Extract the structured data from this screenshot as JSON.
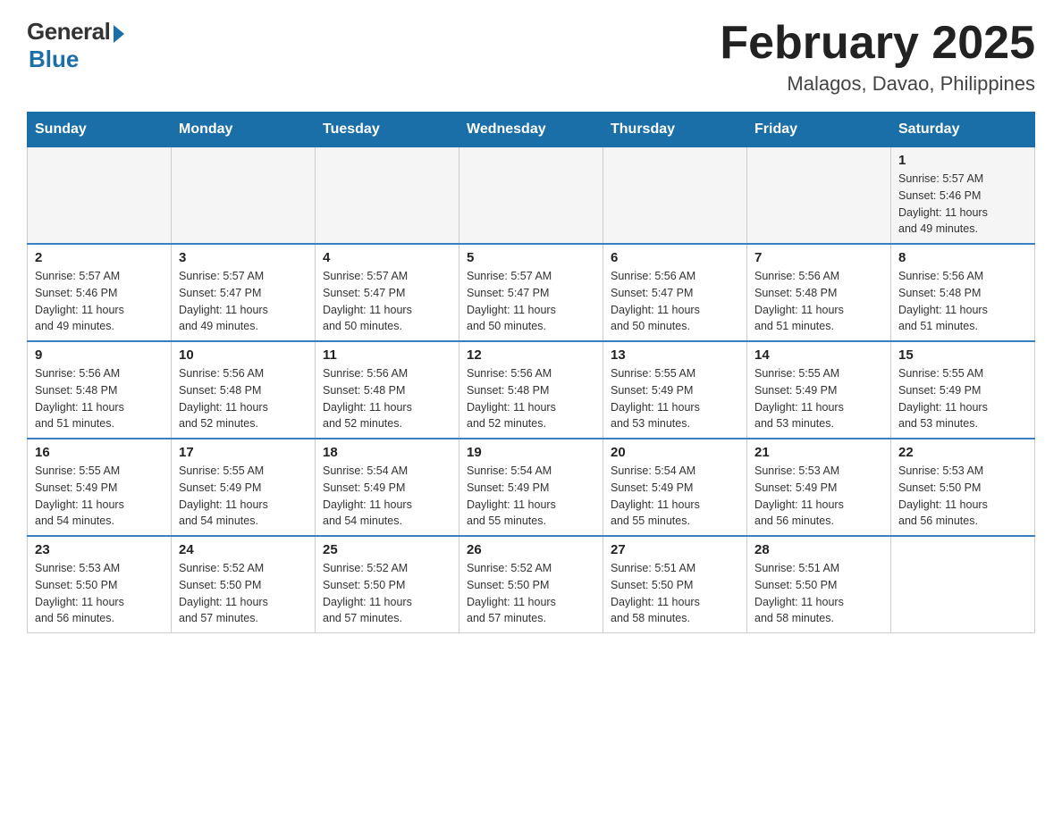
{
  "logo": {
    "general": "General",
    "blue": "Blue"
  },
  "title": "February 2025",
  "subtitle": "Malagos, Davao, Philippines",
  "days_of_week": [
    "Sunday",
    "Monday",
    "Tuesday",
    "Wednesday",
    "Thursday",
    "Friday",
    "Saturday"
  ],
  "weeks": [
    [
      {
        "day": "",
        "info": ""
      },
      {
        "day": "",
        "info": ""
      },
      {
        "day": "",
        "info": ""
      },
      {
        "day": "",
        "info": ""
      },
      {
        "day": "",
        "info": ""
      },
      {
        "day": "",
        "info": ""
      },
      {
        "day": "1",
        "info": "Sunrise: 5:57 AM\nSunset: 5:46 PM\nDaylight: 11 hours\nand 49 minutes."
      }
    ],
    [
      {
        "day": "2",
        "info": "Sunrise: 5:57 AM\nSunset: 5:46 PM\nDaylight: 11 hours\nand 49 minutes."
      },
      {
        "day": "3",
        "info": "Sunrise: 5:57 AM\nSunset: 5:47 PM\nDaylight: 11 hours\nand 49 minutes."
      },
      {
        "day": "4",
        "info": "Sunrise: 5:57 AM\nSunset: 5:47 PM\nDaylight: 11 hours\nand 50 minutes."
      },
      {
        "day": "5",
        "info": "Sunrise: 5:57 AM\nSunset: 5:47 PM\nDaylight: 11 hours\nand 50 minutes."
      },
      {
        "day": "6",
        "info": "Sunrise: 5:56 AM\nSunset: 5:47 PM\nDaylight: 11 hours\nand 50 minutes."
      },
      {
        "day": "7",
        "info": "Sunrise: 5:56 AM\nSunset: 5:48 PM\nDaylight: 11 hours\nand 51 minutes."
      },
      {
        "day": "8",
        "info": "Sunrise: 5:56 AM\nSunset: 5:48 PM\nDaylight: 11 hours\nand 51 minutes."
      }
    ],
    [
      {
        "day": "9",
        "info": "Sunrise: 5:56 AM\nSunset: 5:48 PM\nDaylight: 11 hours\nand 51 minutes."
      },
      {
        "day": "10",
        "info": "Sunrise: 5:56 AM\nSunset: 5:48 PM\nDaylight: 11 hours\nand 52 minutes."
      },
      {
        "day": "11",
        "info": "Sunrise: 5:56 AM\nSunset: 5:48 PM\nDaylight: 11 hours\nand 52 minutes."
      },
      {
        "day": "12",
        "info": "Sunrise: 5:56 AM\nSunset: 5:48 PM\nDaylight: 11 hours\nand 52 minutes."
      },
      {
        "day": "13",
        "info": "Sunrise: 5:55 AM\nSunset: 5:49 PM\nDaylight: 11 hours\nand 53 minutes."
      },
      {
        "day": "14",
        "info": "Sunrise: 5:55 AM\nSunset: 5:49 PM\nDaylight: 11 hours\nand 53 minutes."
      },
      {
        "day": "15",
        "info": "Sunrise: 5:55 AM\nSunset: 5:49 PM\nDaylight: 11 hours\nand 53 minutes."
      }
    ],
    [
      {
        "day": "16",
        "info": "Sunrise: 5:55 AM\nSunset: 5:49 PM\nDaylight: 11 hours\nand 54 minutes."
      },
      {
        "day": "17",
        "info": "Sunrise: 5:55 AM\nSunset: 5:49 PM\nDaylight: 11 hours\nand 54 minutes."
      },
      {
        "day": "18",
        "info": "Sunrise: 5:54 AM\nSunset: 5:49 PM\nDaylight: 11 hours\nand 54 minutes."
      },
      {
        "day": "19",
        "info": "Sunrise: 5:54 AM\nSunset: 5:49 PM\nDaylight: 11 hours\nand 55 minutes."
      },
      {
        "day": "20",
        "info": "Sunrise: 5:54 AM\nSunset: 5:49 PM\nDaylight: 11 hours\nand 55 minutes."
      },
      {
        "day": "21",
        "info": "Sunrise: 5:53 AM\nSunset: 5:49 PM\nDaylight: 11 hours\nand 56 minutes."
      },
      {
        "day": "22",
        "info": "Sunrise: 5:53 AM\nSunset: 5:50 PM\nDaylight: 11 hours\nand 56 minutes."
      }
    ],
    [
      {
        "day": "23",
        "info": "Sunrise: 5:53 AM\nSunset: 5:50 PM\nDaylight: 11 hours\nand 56 minutes."
      },
      {
        "day": "24",
        "info": "Sunrise: 5:52 AM\nSunset: 5:50 PM\nDaylight: 11 hours\nand 57 minutes."
      },
      {
        "day": "25",
        "info": "Sunrise: 5:52 AM\nSunset: 5:50 PM\nDaylight: 11 hours\nand 57 minutes."
      },
      {
        "day": "26",
        "info": "Sunrise: 5:52 AM\nSunset: 5:50 PM\nDaylight: 11 hours\nand 57 minutes."
      },
      {
        "day": "27",
        "info": "Sunrise: 5:51 AM\nSunset: 5:50 PM\nDaylight: 11 hours\nand 58 minutes."
      },
      {
        "day": "28",
        "info": "Sunrise: 5:51 AM\nSunset: 5:50 PM\nDaylight: 11 hours\nand 58 minutes."
      },
      {
        "day": "",
        "info": ""
      }
    ]
  ]
}
